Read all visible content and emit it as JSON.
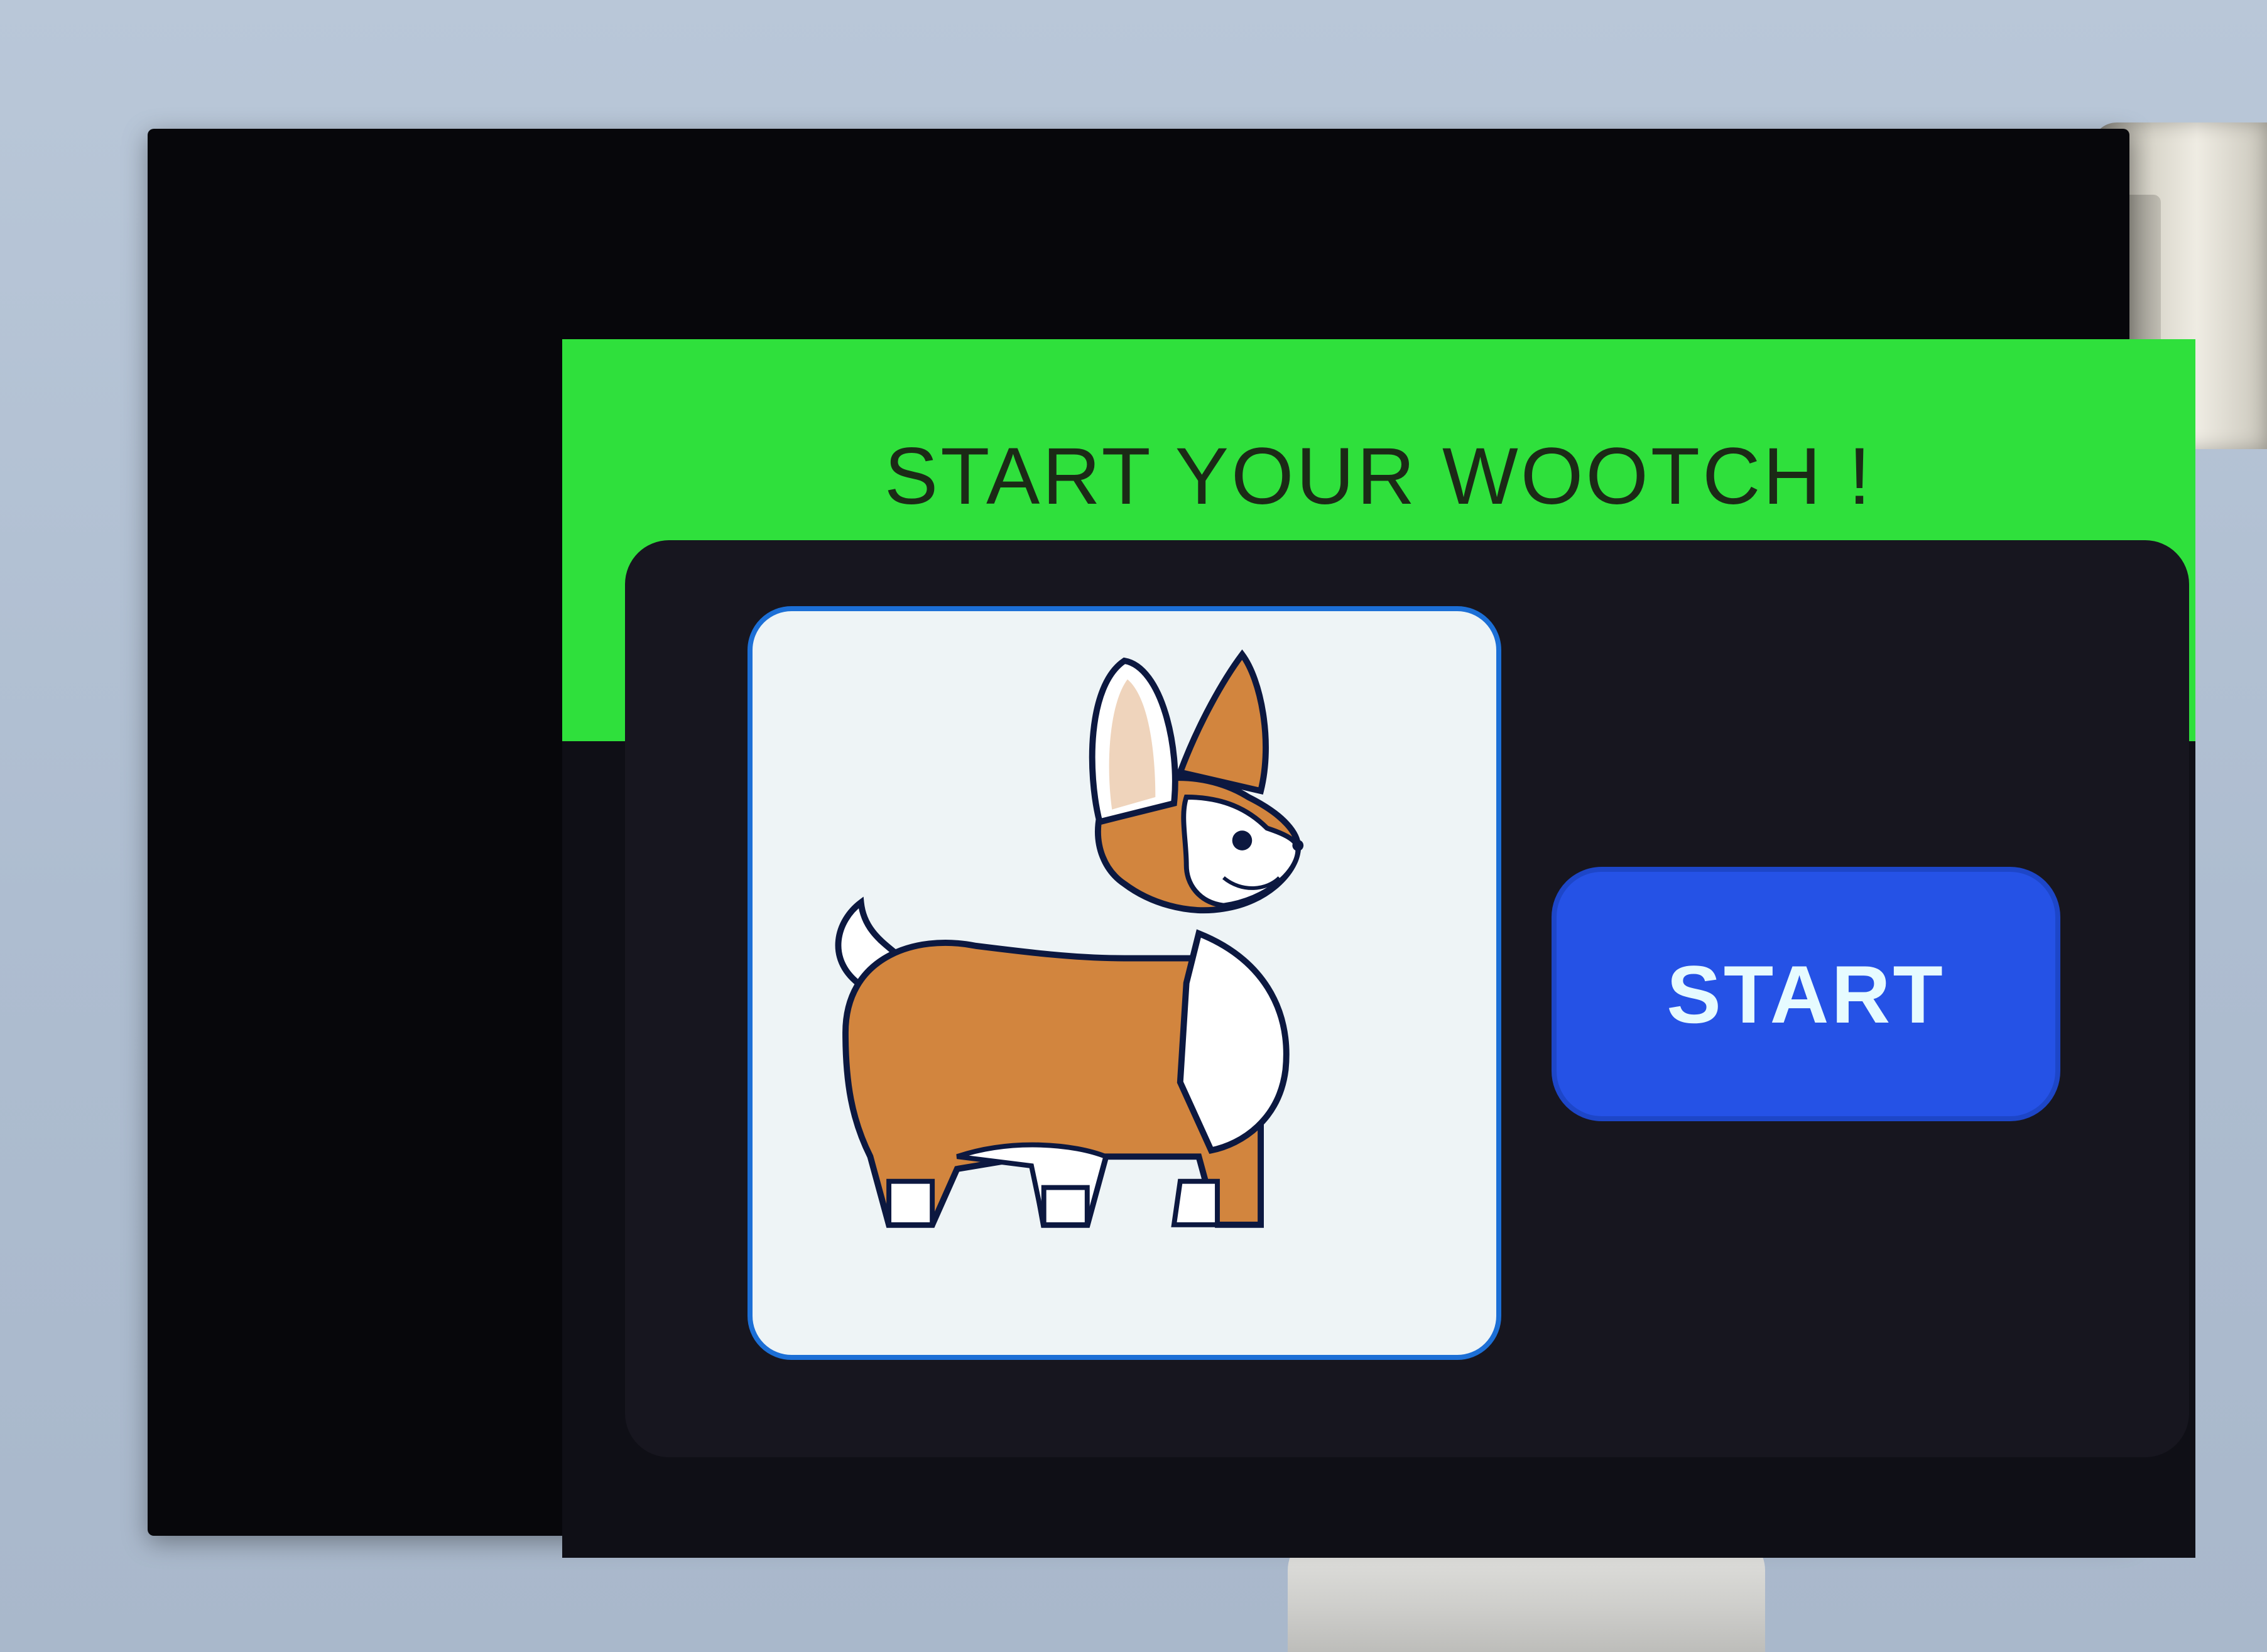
{
  "screen": {
    "header": {
      "title": "START YOUR WOOTCH !"
    },
    "main": {
      "image": {
        "subject": "corgi-illustration"
      },
      "start_button": {
        "label": "START"
      }
    }
  },
  "colors": {
    "header_band": "#2fe03c",
    "panel": "#17161f",
    "button": "#2552e6",
    "button_text": "#e6fbff",
    "title_text": "#1b2a16"
  }
}
